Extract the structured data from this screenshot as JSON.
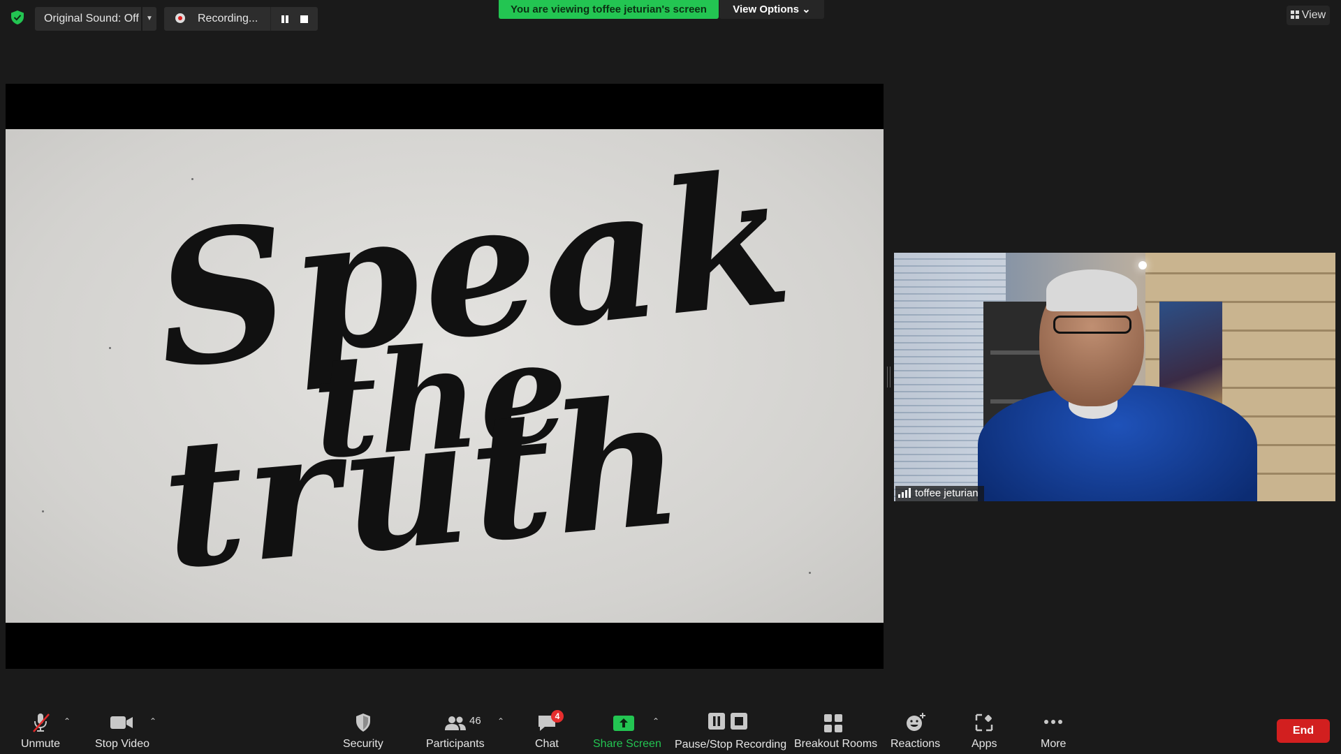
{
  "topbar": {
    "original_sound_label": "Original Sound: Off",
    "recording_label": "Recording...",
    "viewing_banner": "You are viewing toffee jeturian's screen",
    "view_options_label": "View Options ⌄",
    "view_label": "View"
  },
  "shared_screen": {
    "word_1": "Speak",
    "word_2": "the",
    "word_3": "truth"
  },
  "participant": {
    "name": "toffee jeturian"
  },
  "toolbar": {
    "unmute": "Unmute",
    "stop_video": "Stop Video",
    "security": "Security",
    "participants": "Participants",
    "participants_count": "46",
    "chat": "Chat",
    "chat_badge": "4",
    "share_screen": "Share Screen",
    "pause_stop_recording": "Pause/Stop Recording",
    "breakout_rooms": "Breakout Rooms",
    "reactions": "Reactions",
    "apps": "Apps",
    "more": "More",
    "end": "End"
  },
  "colors": {
    "banner_green": "#23c552",
    "end_red": "#d21f1f",
    "share_green": "#23c552",
    "background": "#1a1a1a"
  }
}
